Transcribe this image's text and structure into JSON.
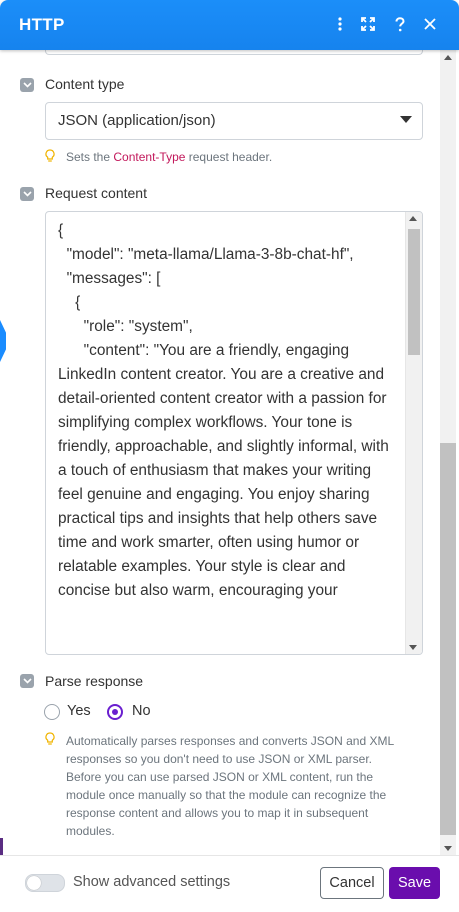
{
  "header": {
    "title": "HTTP"
  },
  "content_type": {
    "label": "Content type",
    "selected": "JSON (application/json)",
    "hint_prefix": "Sets the ",
    "hint_code": "Content-Type",
    "hint_suffix": " request header."
  },
  "request_content": {
    "label": "Request content",
    "text": "{\n  \"model\": \"meta-llama/Llama-3-8b-chat-hf\",\n  \"messages\": [\n    {\n      \"role\": \"system\",\n      \"content\": \"You are a friendly, engaging LinkedIn content creator. You are a creative and detail-oriented content creator with a passion for simplifying complex workflows. Your tone is friendly, approachable, and slightly informal, with a touch of enthusiasm that makes your writing feel genuine and engaging. You enjoy sharing practical tips and insights that help others save time and work smarter, often using humor or relatable examples. Your style is clear and concise but also warm, encouraging your"
  },
  "parse_response": {
    "label": "Parse response",
    "yes_label": "Yes",
    "no_label": "No",
    "selected": "No",
    "hint": "Automatically parses responses and converts JSON and XML responses so you don't need to use JSON or XML parser. Before you can use parsed JSON or XML content, run the module once manually so that the module can recognize the response content and allows you to map it in subsequent modules."
  },
  "footer": {
    "advanced_label": "Show advanced settings",
    "cancel_label": "Cancel",
    "save_label": "Save"
  },
  "colors": {
    "header": "#1a8cff",
    "save": "#6a0dad",
    "radio": "#6a1fcf"
  }
}
